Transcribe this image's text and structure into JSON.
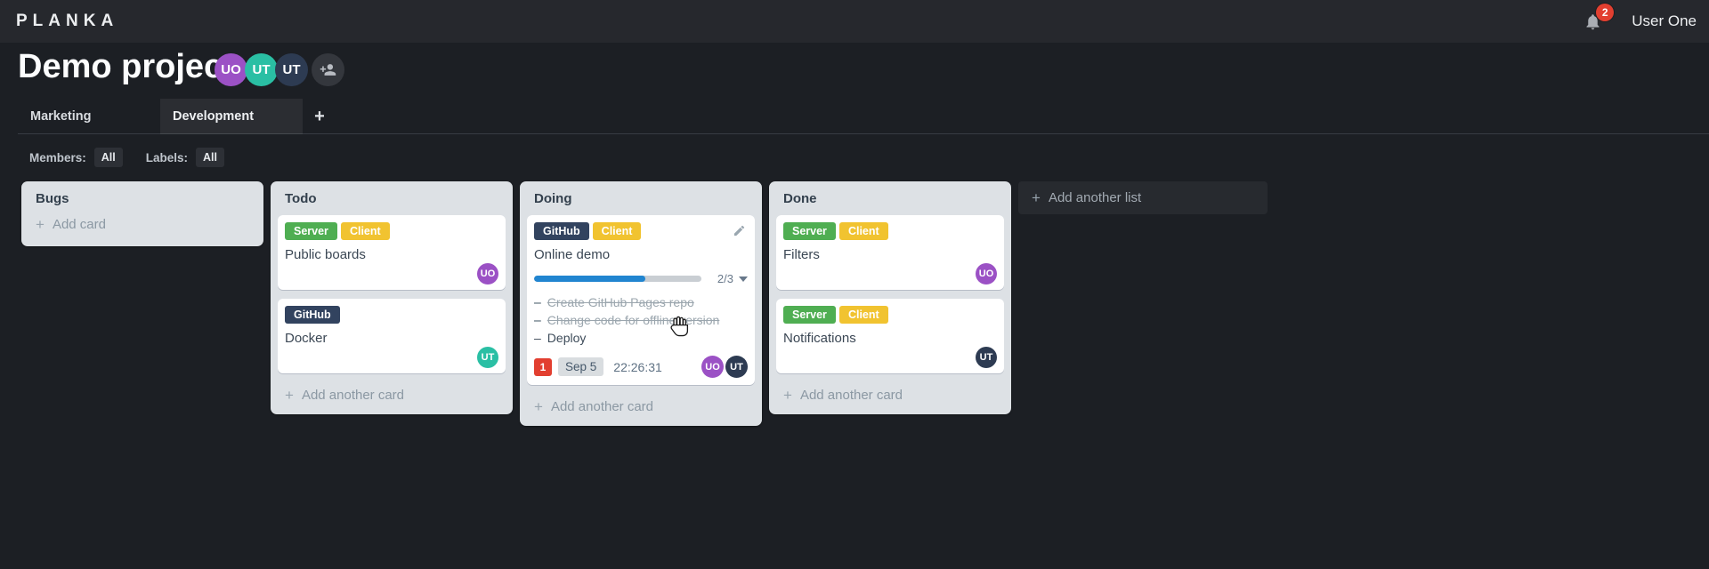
{
  "theme": {
    "page-bg": "#1c1f24",
    "topbar-bg": "#26282d",
    "list-bg": "#dde1e5",
    "card-bg": "#ffffff",
    "label-green": "#4fae52",
    "label-yellow": "#f1c330",
    "label-navy": "#32435f",
    "avatar-purple": "#9b51c5",
    "avatar-teal": "#2abfa4",
    "avatar-navy": "#2d3b52",
    "progress-blue": "#2185d0",
    "badge-red": "#e23f30"
  },
  "topbar": {
    "logo": "PLANKA",
    "notification_count": "2",
    "user_name": "User One"
  },
  "project": {
    "title": "Demo project",
    "members": [
      {
        "initials": "UO"
      },
      {
        "initials": "UT"
      },
      {
        "initials": "UT"
      }
    ]
  },
  "tabs": {
    "items": [
      {
        "label": "Marketing",
        "active": false
      },
      {
        "label": "Development",
        "active": true
      }
    ],
    "add_button": "+"
  },
  "filters": {
    "members_label": "Members:",
    "members_value": "All",
    "labels_label": "Labels:",
    "labels_value": "All"
  },
  "board": {
    "add_list_label": "Add another list",
    "lists": [
      {
        "title": "Bugs",
        "add_card_label": "Add card",
        "cards": []
      },
      {
        "title": "Todo",
        "add_card_label": "Add another card",
        "cards": [
          {
            "title": "Public boards",
            "labels": [
              "Server",
              "Client"
            ],
            "member": "UO"
          },
          {
            "title": "Docker",
            "labels": [
              "GitHub"
            ],
            "member": "UT"
          }
        ]
      },
      {
        "title": "Doing",
        "add_card_label": "Add another card",
        "cards": [
          {
            "title": "Online demo",
            "labels": [
              "GitHub",
              "Client"
            ],
            "progress": {
              "text": "2/3",
              "percent": 66.7
            },
            "tasks": [
              {
                "text": "Create GitHub Pages repo",
                "done": true
              },
              {
                "text": "Change code for offline version",
                "done": true
              },
              {
                "text": "Deploy",
                "done": false
              }
            ],
            "notification_count": "1",
            "due_date": "Sep 5",
            "stopwatch": "22:26:31",
            "members": [
              "UO",
              "UT"
            ]
          }
        ]
      },
      {
        "title": "Done",
        "add_card_label": "Add another card",
        "cards": [
          {
            "title": "Filters",
            "labels": [
              "Server",
              "Client"
            ],
            "member": "UO"
          },
          {
            "title": "Notifications",
            "labels": [
              "Server",
              "Client"
            ],
            "member": "UT"
          }
        ]
      }
    ]
  }
}
